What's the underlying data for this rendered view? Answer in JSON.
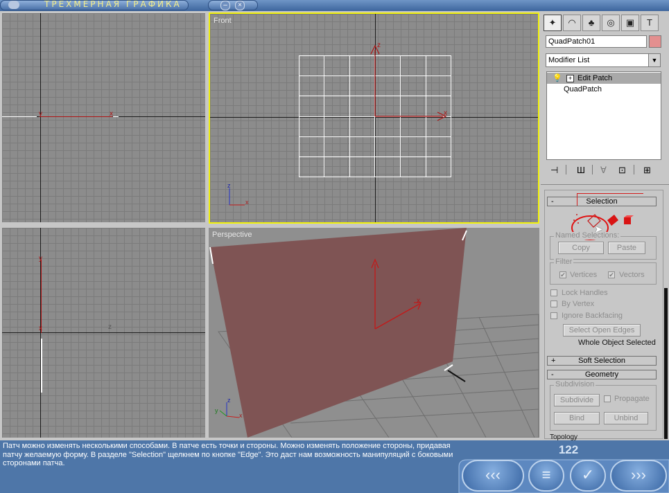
{
  "window": {
    "title": "ТРЕХМЕРНАЯ ГРАФИКА"
  },
  "viewports": {
    "top_left": {
      "label": "",
      "axis_x": "x",
      "axis_y": "y"
    },
    "front": {
      "label": "Front",
      "axis_x": "x",
      "axis_z": "z",
      "gizmo_x": "x",
      "gizmo_z": "z",
      "border_color": "#f2f20a"
    },
    "bottom_left": {
      "axis_y": "y",
      "axis_x": "x",
      "axis_z": "z"
    },
    "perspective": {
      "label": "Perspective",
      "axis_x": "x",
      "axis_y": "y",
      "axis_z": "z",
      "patch_color": "#7f5454"
    }
  },
  "command_panel": {
    "tabs": [
      "create-icon",
      "modify-icon",
      "hierarchy-icon",
      "motion-icon",
      "display-icon",
      "utilities-icon"
    ],
    "object_name": "QuadPatch01",
    "object_color": "#e38f8f",
    "modifier_list": "Modifier List",
    "stack": [
      {
        "label": "Edit Patch",
        "selected": true
      },
      {
        "label": "QuadPatch",
        "selected": false
      }
    ],
    "selection": {
      "title": "Selection",
      "sign": "-",
      "named_selections": "Named Selections:",
      "copy": "Copy",
      "paste": "Paste",
      "filter": "Filter",
      "vertices": "Vertices",
      "vectors": "Vectors",
      "lock_handles": "Lock Handles",
      "by_vertex": "By Vertex",
      "ignore_backfacing": "Ignore Backfacing",
      "select_open_edges": "Select Open Edges",
      "status": "Whole Object Selected"
    },
    "soft_selection": {
      "title": "Soft Selection",
      "sign": "+"
    },
    "geometry": {
      "title": "Geometry",
      "sign": "-",
      "subdivision": "Subdivision",
      "subdivide": "Subdivide",
      "propagate": "Propagate",
      "bind": "Bind",
      "unbind": "Unbind",
      "topology": "Topology"
    }
  },
  "caption": "Патч можно изменять несколькими способами. В патче есть точки и стороны. Можно изменять положение стороны, придавая патчу желаемую форму. В разделе \"Selection\" щелкнем по кнопке \"Edge\". Это даст нам возможность манипуляций с боковыми сторонами патча.",
  "page_number": "122",
  "nav": {
    "back": "‹‹‹",
    "menu": "≡",
    "check": "✓",
    "forward": "›››"
  }
}
